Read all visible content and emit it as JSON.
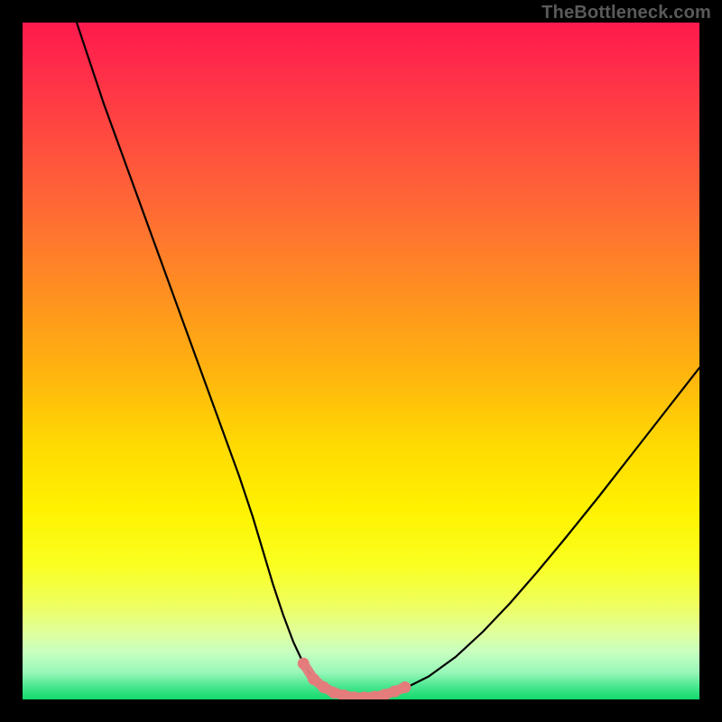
{
  "watermark": {
    "text": "TheBottleneck.com"
  },
  "colors": {
    "curve": "#000000",
    "marker_stroke": "#e47c7c",
    "marker_fill": "#e47c7c"
  },
  "chart_data": {
    "type": "line",
    "title": "",
    "xlabel": "",
    "ylabel": "",
    "xlim": [
      0,
      100
    ],
    "ylim": [
      0,
      100
    ],
    "grid": false,
    "series": [
      {
        "name": "bottleneck-curve",
        "x": [
          8,
          10,
          12,
          14,
          16,
          18,
          20,
          22,
          24,
          26,
          28,
          30,
          32,
          34,
          35.5,
          37,
          38.5,
          40,
          41.5,
          43,
          45,
          47,
          49,
          51,
          53,
          56,
          60,
          64,
          68,
          72,
          76,
          80,
          85,
          90,
          95,
          100
        ],
        "values": [
          100,
          94,
          88,
          82.5,
          77,
          71.5,
          66,
          60.5,
          55,
          49.5,
          44,
          38.5,
          33,
          27,
          22,
          17,
          12.5,
          8.5,
          5.3,
          3.0,
          1.4,
          0.6,
          0.3,
          0.3,
          0.6,
          1.4,
          3.4,
          6.3,
          10.0,
          14.2,
          18.8,
          23.6,
          29.8,
          36.2,
          42.6,
          49.0
        ]
      },
      {
        "name": "optimal-range-markers",
        "x": [
          41.5,
          43.0,
          44.5,
          46.0,
          47.5,
          49.0,
          50.5,
          52.0,
          53.5,
          55.0,
          56.5
        ],
        "values": [
          5.3,
          3.0,
          1.8,
          1.0,
          0.6,
          0.3,
          0.3,
          0.4,
          0.7,
          1.2,
          1.8
        ]
      }
    ]
  }
}
